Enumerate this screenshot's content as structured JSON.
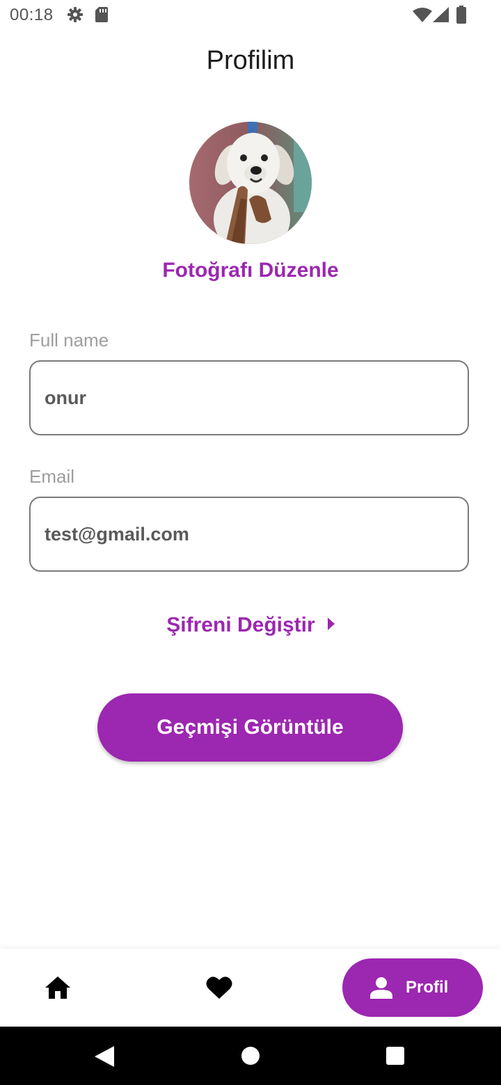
{
  "status_bar": {
    "time": "00:18",
    "icons": [
      "settings-icon",
      "sd-card-icon",
      "wifi-icon",
      "cell-signal-icon",
      "battery-icon"
    ]
  },
  "page": {
    "title": "Profilim"
  },
  "profile_photo": {
    "edit_label": "Fotoğrafı Düzenle"
  },
  "fields": {
    "full_name": {
      "label": "Full name",
      "value": "onur"
    },
    "email": {
      "label": "Email",
      "value": "test@gmail.com"
    }
  },
  "actions": {
    "change_password_label": "Şifreni Değiştir",
    "view_history_label": "Geçmişi Görüntüle"
  },
  "bottom_nav": {
    "items": [
      {
        "icon": "home-icon"
      },
      {
        "icon": "heart-icon"
      },
      {
        "icon": "person-icon",
        "label": "Profil",
        "active": true
      }
    ]
  },
  "system_nav": {
    "icons": [
      "back-icon",
      "home-circle-icon",
      "recents-icon"
    ]
  },
  "colors": {
    "accent": "#9c27b0",
    "text_primary": "#1c1c1c",
    "field_border": "#7a7a7a",
    "label_gray": "#9e9e9e"
  }
}
